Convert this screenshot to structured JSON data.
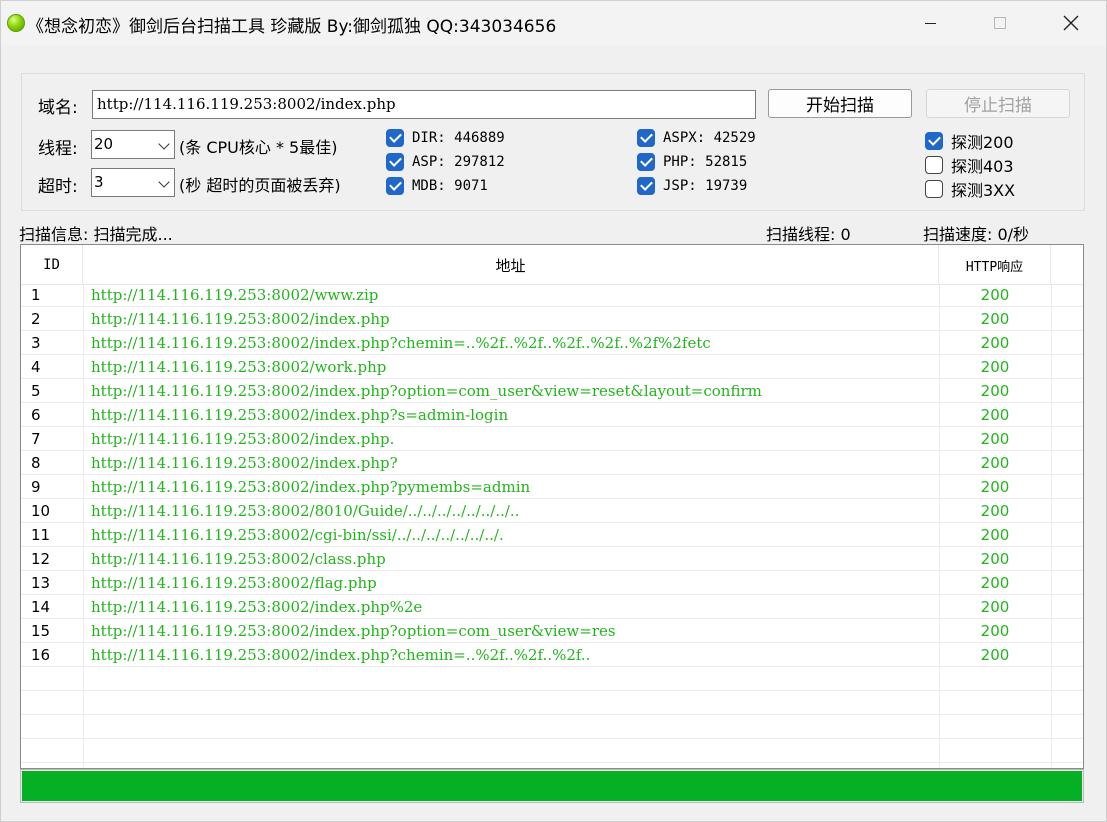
{
  "window": {
    "title": "《想念初恋》御剑后台扫描工具 珍藏版 By:御剑孤独 QQ:343034656"
  },
  "config": {
    "domain_label": "域名:",
    "domain_value": "http://114.116.119.253:8002/index.php",
    "start_button": "开始扫描",
    "stop_button": "停止扫描",
    "threads_label": "线程:",
    "threads_value": "20",
    "threads_hint": "(条 CPU核心 * 5最佳)",
    "timeout_label": "超时:",
    "timeout_value": "3",
    "timeout_hint": "(秒 超时的页面被丢弃)",
    "dicts": [
      {
        "label": "DIR: 446889",
        "checked": true
      },
      {
        "label": "ASP: 297812",
        "checked": true
      },
      {
        "label": "MDB: 9071",
        "checked": true
      },
      {
        "label": "ASPX: 42529",
        "checked": true
      },
      {
        "label": "PHP: 52815",
        "checked": true
      },
      {
        "label": "JSP: 19739",
        "checked": true
      }
    ],
    "detect": [
      {
        "label": "探测200",
        "checked": true
      },
      {
        "label": "探测403",
        "checked": false
      },
      {
        "label": "探测3XX",
        "checked": false
      }
    ]
  },
  "status": {
    "info": "扫描信息: 扫描完成...",
    "threads": "扫描线程: 0",
    "speed": "扫描速度: 0/秒"
  },
  "table": {
    "headers": {
      "id": "ID",
      "url": "地址",
      "code": "HTTP响应"
    },
    "rows": [
      {
        "id": "1",
        "url": "http://114.116.119.253:8002/www.zip",
        "code": "200"
      },
      {
        "id": "2",
        "url": "http://114.116.119.253:8002/index.php",
        "code": "200"
      },
      {
        "id": "3",
        "url": "http://114.116.119.253:8002/index.php?chemin=..%2f..%2f..%2f..%2f..%2f%2fetc",
        "code": "200"
      },
      {
        "id": "4",
        "url": "http://114.116.119.253:8002/work.php",
        "code": "200"
      },
      {
        "id": "5",
        "url": "http://114.116.119.253:8002/index.php?option=com_user&view=reset&layout=confirm",
        "code": "200"
      },
      {
        "id": "6",
        "url": "http://114.116.119.253:8002/index.php?s=admin-login",
        "code": "200"
      },
      {
        "id": "7",
        "url": "http://114.116.119.253:8002/index.php.",
        "code": "200"
      },
      {
        "id": "8",
        "url": "http://114.116.119.253:8002/index.php?",
        "code": "200"
      },
      {
        "id": "9",
        "url": "http://114.116.119.253:8002/index.php?pymembs=admin",
        "code": "200"
      },
      {
        "id": "10",
        "url": "http://114.116.119.253:8002/8010/Guide/../../../../../../../..",
        "code": "200"
      },
      {
        "id": "11",
        "url": "http://114.116.119.253:8002/cgi-bin/ssi/../../../../../../../.",
        "code": "200"
      },
      {
        "id": "12",
        "url": "http://114.116.119.253:8002/class.php",
        "code": "200"
      },
      {
        "id": "13",
        "url": "http://114.116.119.253:8002/flag.php",
        "code": "200"
      },
      {
        "id": "14",
        "url": "http://114.116.119.253:8002/index.php%2e",
        "code": "200"
      },
      {
        "id": "15",
        "url": "http://114.116.119.253:8002/index.php?option=com_user&view=res",
        "code": "200"
      },
      {
        "id": "16",
        "url": "http://114.116.119.253:8002/index.php?chemin=..%2f..%2f..%2f..",
        "code": "200"
      }
    ],
    "empty_rows": 4
  },
  "progress": {
    "fraction": 1.0,
    "color": "#06b025"
  },
  "colors": {
    "result_text": "#22b51c",
    "checkbox": "#1f67c9"
  }
}
